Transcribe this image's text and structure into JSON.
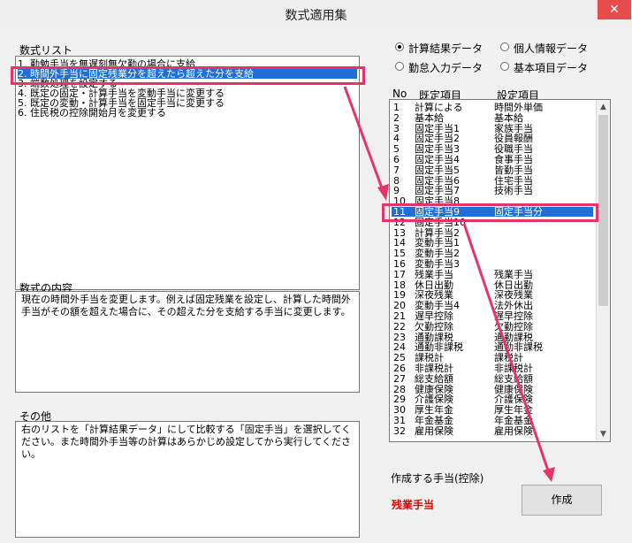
{
  "window": {
    "title": "数式適用集",
    "close_glyph": "✕"
  },
  "formula_list": {
    "label": "数式リスト",
    "items": [
      "1. 勤勉手当を無遅刻無欠勤の場合に支給",
      "2. 時間外手当に固定残業分を超えたら超えた分を支給",
      "3. 端数処理を設定する",
      "4. 既定の固定・計算手当を変動手当に変更する",
      "5. 既定の変動・計算手当を固定手当に変更する",
      "6. 住民税の控除開始月を変更する"
    ],
    "selected_index": 1
  },
  "content": {
    "label": "数式の内容",
    "text": "現在の時間外手当を変更します。例えば固定残業を設定し、計算した時間外手当がその額を超えた場合に、その超えた分を支給する手当に変更します。"
  },
  "other": {
    "label": "その他",
    "text": "右のリストを「計算結果データ」にして比較する「固定手当」を選択してください。また時間外手当等の計算はあらかじめ設定してから実行してください。"
  },
  "radios": [
    {
      "label": "計算結果データ",
      "checked": true
    },
    {
      "label": "個人情報データ",
      "checked": false
    },
    {
      "label": "勤怠入力データ",
      "checked": false
    },
    {
      "label": "基本項目データ",
      "checked": false
    }
  ],
  "table": {
    "headers": [
      "No",
      "既定項目",
      "設定項目"
    ],
    "selected_index": 10,
    "rows": [
      [
        "1",
        "計算による",
        "時間外単価"
      ],
      [
        "2",
        "基本給",
        "基本給"
      ],
      [
        "3",
        "固定手当1",
        "家族手当"
      ],
      [
        "4",
        "固定手当2",
        "役員報酬"
      ],
      [
        "5",
        "固定手当3",
        "役職手当"
      ],
      [
        "6",
        "固定手当4",
        "食事手当"
      ],
      [
        "7",
        "固定手当5",
        "皆勤手当"
      ],
      [
        "8",
        "固定手当6",
        "住宅手当"
      ],
      [
        "9",
        "固定手当7",
        "技術手当"
      ],
      [
        "10",
        "固定手当8",
        ""
      ],
      [
        "11",
        "固定手当9",
        "固定手当分"
      ],
      [
        "12",
        "固定手当10",
        ""
      ],
      [
        "13",
        "計算手当2",
        ""
      ],
      [
        "14",
        "変動手当1",
        ""
      ],
      [
        "15",
        "変動手当2",
        ""
      ],
      [
        "16",
        "変動手当3",
        ""
      ],
      [
        "17",
        "残業手当",
        "残業手当"
      ],
      [
        "18",
        "休日出勤",
        "休日出勤"
      ],
      [
        "19",
        "深夜残業",
        "深夜残業"
      ],
      [
        "20",
        "変動手当4",
        "法外休出"
      ],
      [
        "21",
        "遅早控除",
        "遅早控除"
      ],
      [
        "22",
        "欠勤控除",
        "欠勤控除"
      ],
      [
        "23",
        "通勤課税",
        "通勤課税"
      ],
      [
        "24",
        "通勤非課税",
        "通勤非課税"
      ],
      [
        "25",
        "課税計",
        "課税計"
      ],
      [
        "26",
        "非課税計",
        "非課税計"
      ],
      [
        "27",
        "総支給額",
        "総支給額"
      ],
      [
        "28",
        "健康保険",
        "健康保険"
      ],
      [
        "29",
        "介護保険",
        "介護保険"
      ],
      [
        "30",
        "厚生年金",
        "厚生年金"
      ],
      [
        "31",
        "年金基金",
        "年金基金"
      ],
      [
        "32",
        "雇用保険",
        "雇用保険"
      ]
    ]
  },
  "create_allowance": {
    "label": "作成する手当(控除)",
    "value": "残業手当",
    "value_color": "#e00000"
  },
  "create_button": {
    "label": "作成"
  },
  "annotation_color": "#e8336a",
  "scrollbar_glyphs": {
    "up": "▲",
    "down": "▼"
  }
}
